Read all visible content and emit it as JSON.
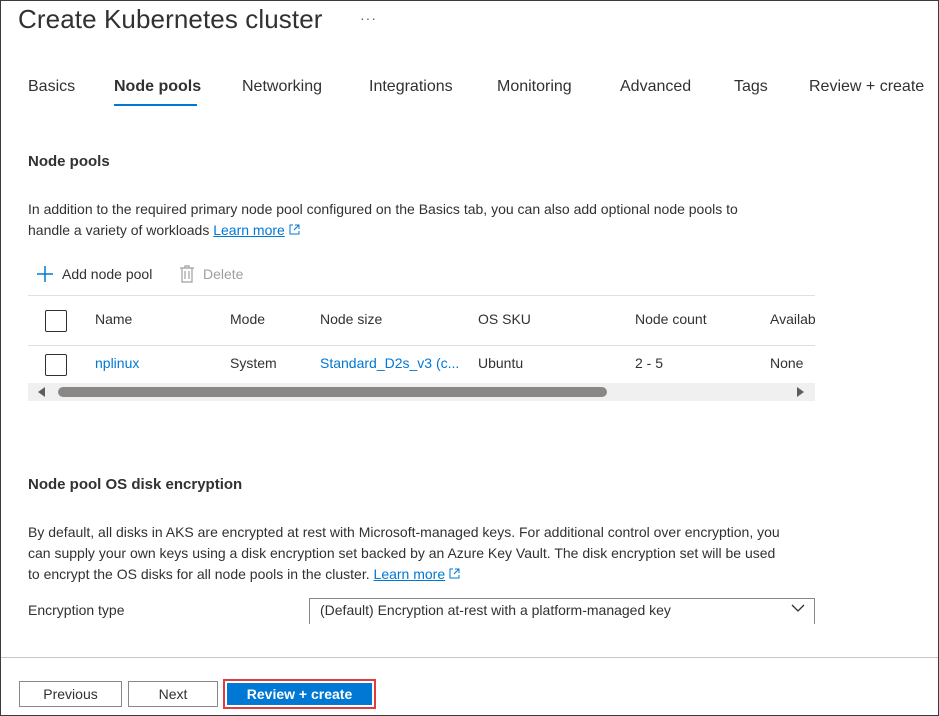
{
  "header": {
    "title": "Create Kubernetes cluster",
    "more": "···"
  },
  "tabs": [
    {
      "label": "Basics"
    },
    {
      "label": "Node pools",
      "active": true
    },
    {
      "label": "Networking"
    },
    {
      "label": "Integrations"
    },
    {
      "label": "Monitoring"
    },
    {
      "label": "Advanced"
    },
    {
      "label": "Tags"
    },
    {
      "label": "Review + create"
    }
  ],
  "node_pools": {
    "heading": "Node pools",
    "description_line1": "In addition to the required primary node pool configured on the Basics tab, you can also add optional node pools to",
    "description_line2": "handle a variety of workloads",
    "learn_more": "Learn more",
    "add_label": "Add node pool",
    "delete_label": "Delete",
    "columns": [
      "Name",
      "Mode",
      "Node size",
      "OS SKU",
      "Node count",
      "Availab"
    ],
    "rows": [
      {
        "name": "nplinux",
        "mode": "System",
        "node_size": "Standard_D2s_v3 (c...",
        "os_sku": "Ubuntu",
        "node_count": "2 - 5",
        "availability": "None"
      }
    ]
  },
  "encryption": {
    "heading": "Node pool OS disk encryption",
    "line1": "By default, all disks in AKS are encrypted at rest with Microsoft-managed keys. For additional control over encryption, you",
    "line2": "can supply your own keys using a disk encryption set backed by an Azure Key Vault. The disk encryption set will be used",
    "line3": "to encrypt the OS disks for all node pools in the cluster.",
    "learn_more": "Learn more",
    "type_label": "Encryption type",
    "type_value": "(Default) Encryption at-rest with a platform-managed key"
  },
  "footer": {
    "previous": "Previous",
    "next": "Next",
    "review_create": "Review + create"
  },
  "colors": {
    "accent": "#0078d4",
    "highlight": "#e03e3e"
  }
}
